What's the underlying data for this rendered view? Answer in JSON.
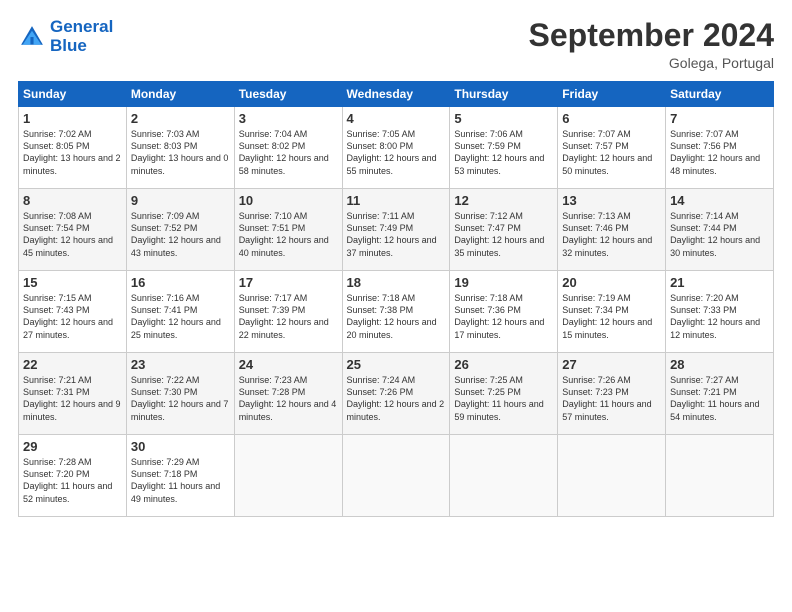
{
  "header": {
    "logo_line1": "General",
    "logo_line2": "Blue",
    "month_year": "September 2024",
    "location": "Golega, Portugal"
  },
  "weekdays": [
    "Sunday",
    "Monday",
    "Tuesday",
    "Wednesday",
    "Thursday",
    "Friday",
    "Saturday"
  ],
  "weeks": [
    [
      {
        "day": "1",
        "sunrise": "7:02 AM",
        "sunset": "8:05 PM",
        "daylight": "13 hours and 2 minutes."
      },
      {
        "day": "2",
        "sunrise": "7:03 AM",
        "sunset": "8:03 PM",
        "daylight": "13 hours and 0 minutes."
      },
      {
        "day": "3",
        "sunrise": "7:04 AM",
        "sunset": "8:02 PM",
        "daylight": "12 hours and 58 minutes."
      },
      {
        "day": "4",
        "sunrise": "7:05 AM",
        "sunset": "8:00 PM",
        "daylight": "12 hours and 55 minutes."
      },
      {
        "day": "5",
        "sunrise": "7:06 AM",
        "sunset": "7:59 PM",
        "daylight": "12 hours and 53 minutes."
      },
      {
        "day": "6",
        "sunrise": "7:07 AM",
        "sunset": "7:57 PM",
        "daylight": "12 hours and 50 minutes."
      },
      {
        "day": "7",
        "sunrise": "7:07 AM",
        "sunset": "7:56 PM",
        "daylight": "12 hours and 48 minutes."
      }
    ],
    [
      {
        "day": "8",
        "sunrise": "7:08 AM",
        "sunset": "7:54 PM",
        "daylight": "12 hours and 45 minutes."
      },
      {
        "day": "9",
        "sunrise": "7:09 AM",
        "sunset": "7:52 PM",
        "daylight": "12 hours and 43 minutes."
      },
      {
        "day": "10",
        "sunrise": "7:10 AM",
        "sunset": "7:51 PM",
        "daylight": "12 hours and 40 minutes."
      },
      {
        "day": "11",
        "sunrise": "7:11 AM",
        "sunset": "7:49 PM",
        "daylight": "12 hours and 37 minutes."
      },
      {
        "day": "12",
        "sunrise": "7:12 AM",
        "sunset": "7:47 PM",
        "daylight": "12 hours and 35 minutes."
      },
      {
        "day": "13",
        "sunrise": "7:13 AM",
        "sunset": "7:46 PM",
        "daylight": "12 hours and 32 minutes."
      },
      {
        "day": "14",
        "sunrise": "7:14 AM",
        "sunset": "7:44 PM",
        "daylight": "12 hours and 30 minutes."
      }
    ],
    [
      {
        "day": "15",
        "sunrise": "7:15 AM",
        "sunset": "7:43 PM",
        "daylight": "12 hours and 27 minutes."
      },
      {
        "day": "16",
        "sunrise": "7:16 AM",
        "sunset": "7:41 PM",
        "daylight": "12 hours and 25 minutes."
      },
      {
        "day": "17",
        "sunrise": "7:17 AM",
        "sunset": "7:39 PM",
        "daylight": "12 hours and 22 minutes."
      },
      {
        "day": "18",
        "sunrise": "7:18 AM",
        "sunset": "7:38 PM",
        "daylight": "12 hours and 20 minutes."
      },
      {
        "day": "19",
        "sunrise": "7:18 AM",
        "sunset": "7:36 PM",
        "daylight": "12 hours and 17 minutes."
      },
      {
        "day": "20",
        "sunrise": "7:19 AM",
        "sunset": "7:34 PM",
        "daylight": "12 hours and 15 minutes."
      },
      {
        "day": "21",
        "sunrise": "7:20 AM",
        "sunset": "7:33 PM",
        "daylight": "12 hours and 12 minutes."
      }
    ],
    [
      {
        "day": "22",
        "sunrise": "7:21 AM",
        "sunset": "7:31 PM",
        "daylight": "12 hours and 9 minutes."
      },
      {
        "day": "23",
        "sunrise": "7:22 AM",
        "sunset": "7:30 PM",
        "daylight": "12 hours and 7 minutes."
      },
      {
        "day": "24",
        "sunrise": "7:23 AM",
        "sunset": "7:28 PM",
        "daylight": "12 hours and 4 minutes."
      },
      {
        "day": "25",
        "sunrise": "7:24 AM",
        "sunset": "7:26 PM",
        "daylight": "12 hours and 2 minutes."
      },
      {
        "day": "26",
        "sunrise": "7:25 AM",
        "sunset": "7:25 PM",
        "daylight": "11 hours and 59 minutes."
      },
      {
        "day": "27",
        "sunrise": "7:26 AM",
        "sunset": "7:23 PM",
        "daylight": "11 hours and 57 minutes."
      },
      {
        "day": "28",
        "sunrise": "7:27 AM",
        "sunset": "7:21 PM",
        "daylight": "11 hours and 54 minutes."
      }
    ],
    [
      {
        "day": "29",
        "sunrise": "7:28 AM",
        "sunset": "7:20 PM",
        "daylight": "11 hours and 52 minutes."
      },
      {
        "day": "30",
        "sunrise": "7:29 AM",
        "sunset": "7:18 PM",
        "daylight": "11 hours and 49 minutes."
      },
      null,
      null,
      null,
      null,
      null
    ]
  ]
}
